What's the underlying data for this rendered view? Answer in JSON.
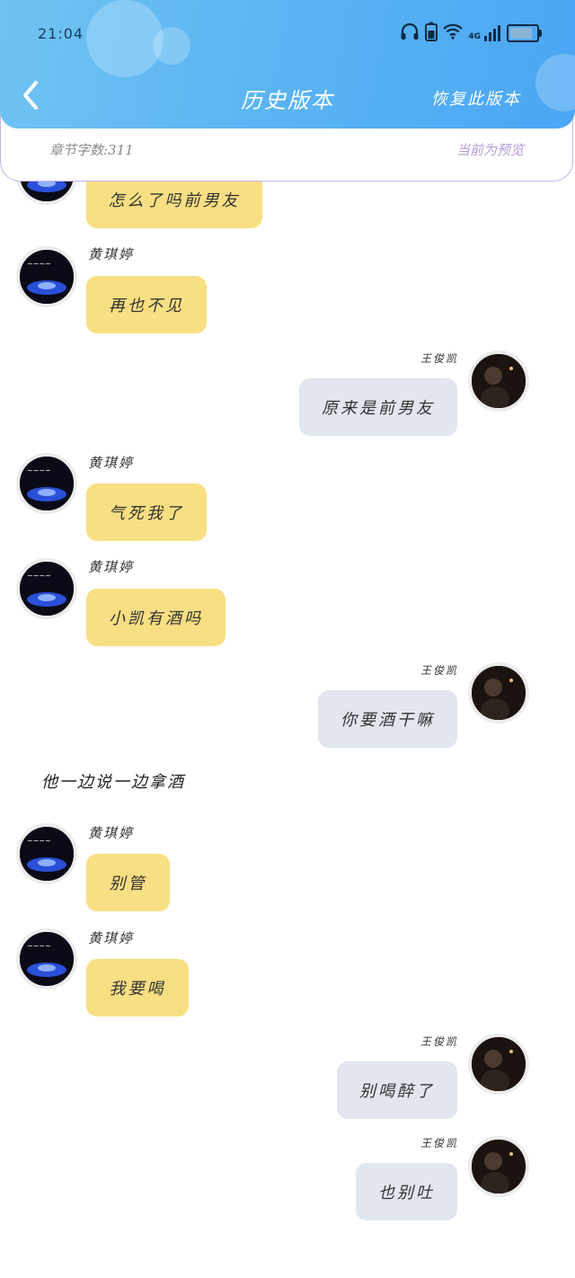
{
  "status": {
    "time": "21:04",
    "signal_label": "4G"
  },
  "header": {
    "title": "历史版本",
    "restore_label": "恢复此版本"
  },
  "info": {
    "word_count": "章节字数:311",
    "preview": "当前为预览"
  },
  "characters": {
    "left_name": "黄琪婷",
    "right_name": "王俊凯"
  },
  "messages": [
    {
      "side": "left",
      "text": "怎么了吗前男友"
    },
    {
      "side": "left",
      "name": "黄琪婷",
      "text": "再也不见"
    },
    {
      "side": "right",
      "name": "王俊凯",
      "text": "原来是前男友"
    },
    {
      "side": "left",
      "name": "黄琪婷",
      "text": "气死我了"
    },
    {
      "side": "left",
      "name": "黄琪婷",
      "text": "小凯有酒吗"
    },
    {
      "side": "right",
      "name": "王俊凯",
      "text": "你要酒干嘛"
    },
    {
      "side": "left",
      "name": "黄琪婷",
      "text": "别管"
    },
    {
      "side": "left",
      "name": "黄琪婷",
      "text": "我要喝"
    },
    {
      "side": "right",
      "name": "王俊凯",
      "text": "别喝醉了"
    },
    {
      "side": "right",
      "name": "王俊凯",
      "text": "也别吐"
    }
  ],
  "narration": "他一边说一边拿酒",
  "colors": {
    "header": "#5ab4f3",
    "left_bubble": "#f8df83",
    "right_bubble": "#e1e6ef",
    "info_border": "#c9b3e8"
  }
}
